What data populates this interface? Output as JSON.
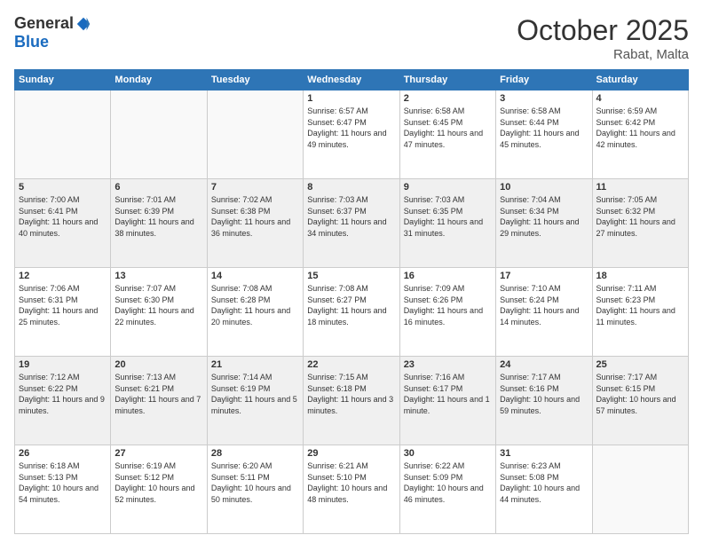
{
  "logo": {
    "general": "General",
    "blue": "Blue"
  },
  "title": "October 2025",
  "location": "Rabat, Malta",
  "days_of_week": [
    "Sunday",
    "Monday",
    "Tuesday",
    "Wednesday",
    "Thursday",
    "Friday",
    "Saturday"
  ],
  "weeks": [
    [
      {
        "num": "",
        "info": ""
      },
      {
        "num": "",
        "info": ""
      },
      {
        "num": "",
        "info": ""
      },
      {
        "num": "1",
        "info": "Sunrise: 6:57 AM\nSunset: 6:47 PM\nDaylight: 11 hours and 49 minutes."
      },
      {
        "num": "2",
        "info": "Sunrise: 6:58 AM\nSunset: 6:45 PM\nDaylight: 11 hours and 47 minutes."
      },
      {
        "num": "3",
        "info": "Sunrise: 6:58 AM\nSunset: 6:44 PM\nDaylight: 11 hours and 45 minutes."
      },
      {
        "num": "4",
        "info": "Sunrise: 6:59 AM\nSunset: 6:42 PM\nDaylight: 11 hours and 42 minutes."
      }
    ],
    [
      {
        "num": "5",
        "info": "Sunrise: 7:00 AM\nSunset: 6:41 PM\nDaylight: 11 hours and 40 minutes."
      },
      {
        "num": "6",
        "info": "Sunrise: 7:01 AM\nSunset: 6:39 PM\nDaylight: 11 hours and 38 minutes."
      },
      {
        "num": "7",
        "info": "Sunrise: 7:02 AM\nSunset: 6:38 PM\nDaylight: 11 hours and 36 minutes."
      },
      {
        "num": "8",
        "info": "Sunrise: 7:03 AM\nSunset: 6:37 PM\nDaylight: 11 hours and 34 minutes."
      },
      {
        "num": "9",
        "info": "Sunrise: 7:03 AM\nSunset: 6:35 PM\nDaylight: 11 hours and 31 minutes."
      },
      {
        "num": "10",
        "info": "Sunrise: 7:04 AM\nSunset: 6:34 PM\nDaylight: 11 hours and 29 minutes."
      },
      {
        "num": "11",
        "info": "Sunrise: 7:05 AM\nSunset: 6:32 PM\nDaylight: 11 hours and 27 minutes."
      }
    ],
    [
      {
        "num": "12",
        "info": "Sunrise: 7:06 AM\nSunset: 6:31 PM\nDaylight: 11 hours and 25 minutes."
      },
      {
        "num": "13",
        "info": "Sunrise: 7:07 AM\nSunset: 6:30 PM\nDaylight: 11 hours and 22 minutes."
      },
      {
        "num": "14",
        "info": "Sunrise: 7:08 AM\nSunset: 6:28 PM\nDaylight: 11 hours and 20 minutes."
      },
      {
        "num": "15",
        "info": "Sunrise: 7:08 AM\nSunset: 6:27 PM\nDaylight: 11 hours and 18 minutes."
      },
      {
        "num": "16",
        "info": "Sunrise: 7:09 AM\nSunset: 6:26 PM\nDaylight: 11 hours and 16 minutes."
      },
      {
        "num": "17",
        "info": "Sunrise: 7:10 AM\nSunset: 6:24 PM\nDaylight: 11 hours and 14 minutes."
      },
      {
        "num": "18",
        "info": "Sunrise: 7:11 AM\nSunset: 6:23 PM\nDaylight: 11 hours and 11 minutes."
      }
    ],
    [
      {
        "num": "19",
        "info": "Sunrise: 7:12 AM\nSunset: 6:22 PM\nDaylight: 11 hours and 9 minutes."
      },
      {
        "num": "20",
        "info": "Sunrise: 7:13 AM\nSunset: 6:21 PM\nDaylight: 11 hours and 7 minutes."
      },
      {
        "num": "21",
        "info": "Sunrise: 7:14 AM\nSunset: 6:19 PM\nDaylight: 11 hours and 5 minutes."
      },
      {
        "num": "22",
        "info": "Sunrise: 7:15 AM\nSunset: 6:18 PM\nDaylight: 11 hours and 3 minutes."
      },
      {
        "num": "23",
        "info": "Sunrise: 7:16 AM\nSunset: 6:17 PM\nDaylight: 11 hours and 1 minute."
      },
      {
        "num": "24",
        "info": "Sunrise: 7:17 AM\nSunset: 6:16 PM\nDaylight: 10 hours and 59 minutes."
      },
      {
        "num": "25",
        "info": "Sunrise: 7:17 AM\nSunset: 6:15 PM\nDaylight: 10 hours and 57 minutes."
      }
    ],
    [
      {
        "num": "26",
        "info": "Sunrise: 6:18 AM\nSunset: 5:13 PM\nDaylight: 10 hours and 54 minutes."
      },
      {
        "num": "27",
        "info": "Sunrise: 6:19 AM\nSunset: 5:12 PM\nDaylight: 10 hours and 52 minutes."
      },
      {
        "num": "28",
        "info": "Sunrise: 6:20 AM\nSunset: 5:11 PM\nDaylight: 10 hours and 50 minutes."
      },
      {
        "num": "29",
        "info": "Sunrise: 6:21 AM\nSunset: 5:10 PM\nDaylight: 10 hours and 48 minutes."
      },
      {
        "num": "30",
        "info": "Sunrise: 6:22 AM\nSunset: 5:09 PM\nDaylight: 10 hours and 46 minutes."
      },
      {
        "num": "31",
        "info": "Sunrise: 6:23 AM\nSunset: 5:08 PM\nDaylight: 10 hours and 44 minutes."
      },
      {
        "num": "",
        "info": ""
      }
    ]
  ]
}
